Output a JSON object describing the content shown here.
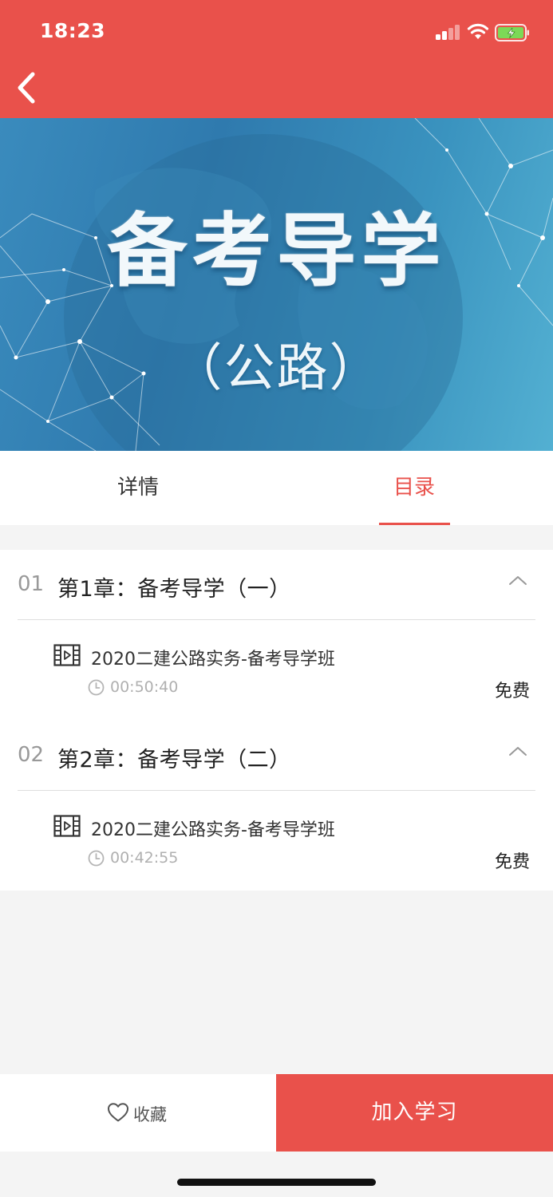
{
  "status": {
    "time": "18:23"
  },
  "banner": {
    "title": "备考导学",
    "subtitle": "（公路）"
  },
  "tabs": {
    "detail": "详情",
    "catalog": "目录"
  },
  "chapters": [
    {
      "number": "01",
      "title": "第1章：备考导学（一）",
      "lesson": {
        "title": "2020二建公路实务-备考导学班",
        "duration": "00:50:40",
        "price": "免费"
      }
    },
    {
      "number": "02",
      "title": "第2章：备考导学（二）",
      "lesson": {
        "title": "2020二建公路实务-备考导学班",
        "duration": "00:42:55",
        "price": "免费"
      }
    }
  ],
  "bottom": {
    "favorite": "收藏",
    "join": "加入学习"
  },
  "colors": {
    "brand": "#e9514b",
    "banner": "#3a8bbd"
  }
}
